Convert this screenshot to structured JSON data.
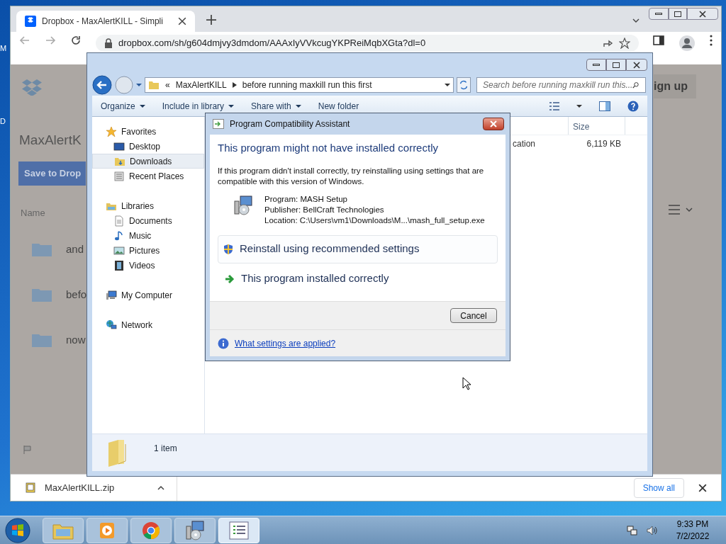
{
  "desktop": {
    "icon_labels": [
      "M",
      "D"
    ]
  },
  "browser": {
    "tabs": [
      {
        "title": "Dropbox - MaxAlertKILL - Simpli",
        "selected": true
      }
    ],
    "address": "dropbox.com/sh/g604dmjvy3dmdom/AAAxIyVVkcugYKPReiMqbXGta?dl=0",
    "page": {
      "title": "MaxAlertK",
      "save_button": "Save to Drop",
      "signup_button": "ign up",
      "name_header": "Name",
      "rows": [
        {
          "name": "and"
        },
        {
          "name": "befo"
        },
        {
          "name": "now"
        }
      ]
    },
    "download": {
      "file": "MaxAlertKILL.zip",
      "show_all": "Show all"
    }
  },
  "explorer": {
    "breadcrumb_overflow": "«",
    "breadcrumb": [
      "MaxAlertKILL",
      "before running maxkill run this first"
    ],
    "search_placeholder": "Search before running maxkill run this...",
    "toolbar": [
      {
        "label": "Organize",
        "menu": true
      },
      {
        "label": "Include in library",
        "menu": true
      },
      {
        "label": "Share with",
        "menu": true
      },
      {
        "label": "New folder",
        "menu": false
      }
    ],
    "nav": [
      {
        "label": "Favorites",
        "kind": "star",
        "selected": false,
        "children": [
          {
            "label": "Desktop",
            "kind": "desktop",
            "selected": false
          },
          {
            "label": "Downloads",
            "kind": "downloads",
            "selected": true
          },
          {
            "label": "Recent Places",
            "kind": "recent",
            "selected": false
          }
        ]
      },
      {
        "label": "Libraries",
        "kind": "library",
        "selected": false,
        "children": [
          {
            "label": "Documents",
            "kind": "document",
            "selected": false
          },
          {
            "label": "Music",
            "kind": "music",
            "selected": false
          },
          {
            "label": "Pictures",
            "kind": "pictures",
            "selected": false
          },
          {
            "label": "Videos",
            "kind": "videos",
            "selected": false
          }
        ]
      },
      {
        "label": "My Computer",
        "kind": "computer",
        "selected": false
      },
      {
        "label": "Network",
        "kind": "network",
        "selected": false
      }
    ],
    "columns": [
      "Size"
    ],
    "rows": [
      {
        "type": "cation",
        "size": "6,119 KB"
      }
    ],
    "status": "1 item"
  },
  "dialog": {
    "title": "Program Compatibility Assistant",
    "heading": "This program might not have installed correctly",
    "message": "If this program didn't install correctly, try reinstalling using settings that are compatible with this version of Windows.",
    "details": [
      "Program: MASH Setup",
      "Publisher: BellCraft Technologies",
      "Location: C:\\Users\\vm1\\Downloads\\M...\\mash_full_setup.exe"
    ],
    "options": [
      {
        "label": "Reinstall using recommended settings",
        "kind": "shield",
        "selected": true
      },
      {
        "label": "This program installed correctly",
        "kind": "arrow",
        "selected": false
      }
    ],
    "cancel": "Cancel",
    "help_link": "What settings are applied?"
  },
  "taskbar": {
    "apps": [
      {
        "kind": "explorer",
        "selected": false
      },
      {
        "kind": "media",
        "selected": false
      },
      {
        "kind": "chrome",
        "selected": false
      },
      {
        "kind": "setup",
        "selected": false
      },
      {
        "kind": "list",
        "selected": true
      }
    ],
    "time": "9:33 PM",
    "date": "7/2/2022"
  }
}
